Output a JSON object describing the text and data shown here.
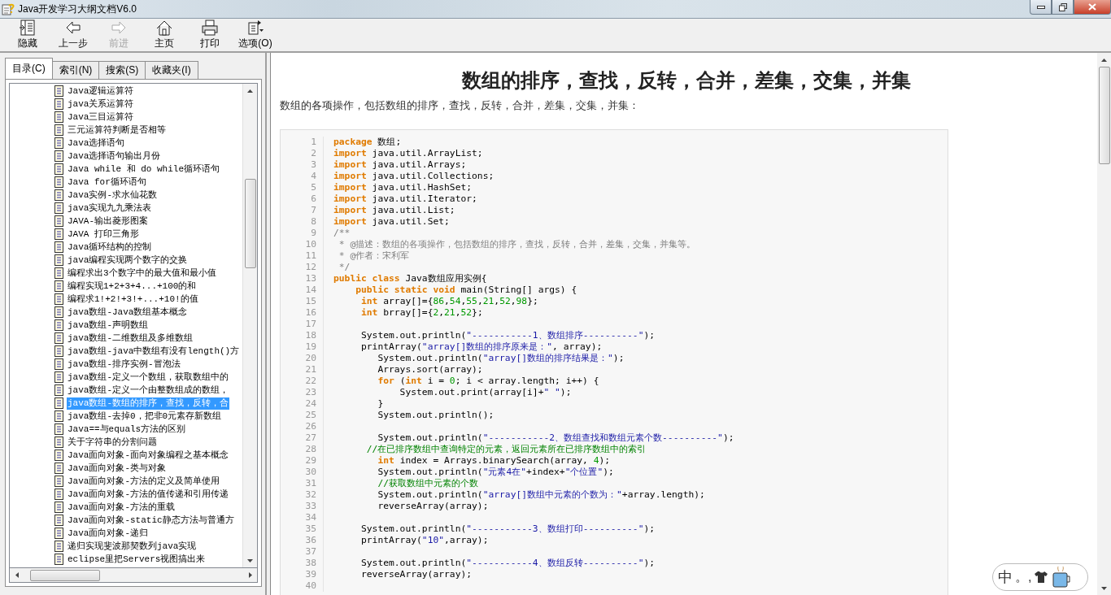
{
  "window": {
    "title": "Java开发学习大纲文档V6.0"
  },
  "toolbar": [
    {
      "label": "隐藏",
      "kind": "hide",
      "disabled": false
    },
    {
      "label": "上一步",
      "kind": "back",
      "disabled": false
    },
    {
      "label": "前进",
      "kind": "forward",
      "disabled": true
    },
    {
      "label": "主页",
      "kind": "home",
      "disabled": false
    },
    {
      "label": "打印",
      "kind": "print",
      "disabled": false
    },
    {
      "label": "选项(O)",
      "kind": "options",
      "disabled": false
    }
  ],
  "tabs": [
    {
      "label": "目录(C)",
      "selected": true
    },
    {
      "label": "索引(N)",
      "selected": false
    },
    {
      "label": "搜索(S)",
      "selected": false
    },
    {
      "label": "收藏夹(I)",
      "selected": false
    }
  ],
  "tree": {
    "items": [
      {
        "label": "Java逻辑运算符",
        "selected": false
      },
      {
        "label": "java关系运算符",
        "selected": false
      },
      {
        "label": "Java三目运算符",
        "selected": false
      },
      {
        "label": "三元运算符判断是否相等",
        "selected": false
      },
      {
        "label": "Java选择语句",
        "selected": false
      },
      {
        "label": "Java选择语句输出月份",
        "selected": false
      },
      {
        "label": "Java while 和 do while循环语句",
        "selected": false
      },
      {
        "label": "Java for循环语句",
        "selected": false
      },
      {
        "label": "Java实例-求水仙花数",
        "selected": false
      },
      {
        "label": "java实现九九乘法表",
        "selected": false
      },
      {
        "label": "JAVA-输出菱形图案",
        "selected": false
      },
      {
        "label": "JAVA 打印三角形",
        "selected": false
      },
      {
        "label": "Java循环结构的控制",
        "selected": false
      },
      {
        "label": "java编程实现两个数字的交换",
        "selected": false
      },
      {
        "label": "编程求出3个数字中的最大值和最小值",
        "selected": false
      },
      {
        "label": "编程实现1+2+3+4...+100的和",
        "selected": false
      },
      {
        "label": "编程求1!+2!+3!+...+10!的值",
        "selected": false
      },
      {
        "label": "java数组-Java数组基本概念",
        "selected": false
      },
      {
        "label": "java数组-声明数组",
        "selected": false
      },
      {
        "label": "java数组-二维数组及多维数组",
        "selected": false
      },
      {
        "label": "java数组-java中数组有没有length()方",
        "selected": false
      },
      {
        "label": "java数组-排序实例-冒泡法",
        "selected": false
      },
      {
        "label": "java数组-定义一个数组，获取数组中的",
        "selected": false
      },
      {
        "label": "java数组-定义一个由整数组成的数组，",
        "selected": false
      },
      {
        "label": "java数组-数组的排序，查找，反转，合",
        "selected": true
      },
      {
        "label": "java数组-去掉0，把非0元素存新数组",
        "selected": false
      },
      {
        "label": "Java==与equals方法的区别",
        "selected": false
      },
      {
        "label": "关于字符串的分割问题",
        "selected": false
      },
      {
        "label": "Java面向对象-面向对象编程之基本概念",
        "selected": false
      },
      {
        "label": "Java面向对象-类与对象",
        "selected": false
      },
      {
        "label": "Java面向对象-方法的定义及简单使用",
        "selected": false
      },
      {
        "label": "Java面向对象-方法的值传递和引用传递",
        "selected": false
      },
      {
        "label": "Java面向对象-方法的重载",
        "selected": false
      },
      {
        "label": "Java面向对象-static静态方法与普通方",
        "selected": false
      },
      {
        "label": "Java面向对象-递归",
        "selected": false
      },
      {
        "label": "递归实现斐波那契数列java实现",
        "selected": false
      },
      {
        "label": "eclipse里把Servers视图搞出来",
        "selected": false
      }
    ]
  },
  "article": {
    "heading": "数组的排序，查找，反转，合并，差集，交集，并集",
    "intro": "数组的各项操作，包括数组的排序，查找，反转，合并，差集，交集，并集：",
    "code": [
      {
        "no": "1",
        "tokens": [
          {
            "kind": "kw",
            "text": "package"
          },
          {
            "kind": "plain",
            "text": " 数组;"
          }
        ]
      },
      {
        "no": "2",
        "tokens": [
          {
            "kind": "kw",
            "text": "import"
          },
          {
            "kind": "plain",
            "text": " java.util.ArrayList;"
          }
        ]
      },
      {
        "no": "3",
        "tokens": [
          {
            "kind": "kw",
            "text": "import"
          },
          {
            "kind": "plain",
            "text": " java.util.Arrays;"
          }
        ]
      },
      {
        "no": "4",
        "tokens": [
          {
            "kind": "kw",
            "text": "import"
          },
          {
            "kind": "plain",
            "text": " java.util.Collections;"
          }
        ]
      },
      {
        "no": "5",
        "tokens": [
          {
            "kind": "kw",
            "text": "import"
          },
          {
            "kind": "plain",
            "text": " java.util.HashSet;"
          }
        ]
      },
      {
        "no": "6",
        "tokens": [
          {
            "kind": "kw",
            "text": "import"
          },
          {
            "kind": "plain",
            "text": " java.util.Iterator;"
          }
        ]
      },
      {
        "no": "7",
        "tokens": [
          {
            "kind": "kw",
            "text": "import"
          },
          {
            "kind": "plain",
            "text": " java.util.List;"
          }
        ]
      },
      {
        "no": "8",
        "tokens": [
          {
            "kind": "kw",
            "text": "import"
          },
          {
            "kind": "plain",
            "text": " java.util.Set;"
          }
        ]
      },
      {
        "no": "9",
        "tokens": [
          {
            "kind": "doc",
            "text": "/**"
          }
        ]
      },
      {
        "no": "10",
        "tokens": [
          {
            "kind": "doc",
            "text": " * @描述：数组的各项操作，包括数组的排序，查找，反转，合并，差集，交集，并集等。"
          }
        ]
      },
      {
        "no": "11",
        "tokens": [
          {
            "kind": "doc",
            "text": " * @作者：宋利军"
          }
        ]
      },
      {
        "no": "12",
        "tokens": [
          {
            "kind": "doc",
            "text": " */"
          }
        ]
      },
      {
        "no": "13",
        "tokens": [
          {
            "kind": "kw",
            "text": "public class"
          },
          {
            "kind": "plain",
            "text": " Java数组应用实例{"
          }
        ]
      },
      {
        "no": "14",
        "tokens": [
          {
            "kind": "kw",
            "text": "    public static void"
          },
          {
            "kind": "plain",
            "text": " main(String[] args) {"
          }
        ]
      },
      {
        "no": "15",
        "tokens": [
          {
            "kind": "kw",
            "text": "     int"
          },
          {
            "kind": "plain",
            "text": " array[]={"
          },
          {
            "kind": "num",
            "text": "86"
          },
          {
            "kind": "plain",
            "text": ","
          },
          {
            "kind": "num",
            "text": "54"
          },
          {
            "kind": "plain",
            "text": ","
          },
          {
            "kind": "num",
            "text": "55"
          },
          {
            "kind": "plain",
            "text": ","
          },
          {
            "kind": "num",
            "text": "21"
          },
          {
            "kind": "plain",
            "text": ","
          },
          {
            "kind": "num",
            "text": "52"
          },
          {
            "kind": "plain",
            "text": ","
          },
          {
            "kind": "num",
            "text": "98"
          },
          {
            "kind": "plain",
            "text": "};"
          }
        ]
      },
      {
        "no": "16",
        "tokens": [
          {
            "kind": "kw",
            "text": "     int"
          },
          {
            "kind": "plain",
            "text": " brray[]={"
          },
          {
            "kind": "num",
            "text": "2"
          },
          {
            "kind": "plain",
            "text": ","
          },
          {
            "kind": "num",
            "text": "21"
          },
          {
            "kind": "plain",
            "text": ","
          },
          {
            "kind": "num",
            "text": "52"
          },
          {
            "kind": "plain",
            "text": "};"
          }
        ]
      },
      {
        "no": "17"
      },
      {
        "no": "18",
        "tokens": [
          {
            "kind": "plain",
            "text": "     System.out.println("
          },
          {
            "kind": "str",
            "text": "\"-----------1、数组排序----------\""
          },
          {
            "kind": "plain",
            "text": ");"
          }
        ]
      },
      {
        "no": "19",
        "tokens": [
          {
            "kind": "plain",
            "text": "     printArray("
          },
          {
            "kind": "str",
            "text": "\"array[]数组的排序原来是：\""
          },
          {
            "kind": "plain",
            "text": ", array);"
          }
        ]
      },
      {
        "no": "20",
        "tokens": [
          {
            "kind": "plain",
            "text": "        System.out.println("
          },
          {
            "kind": "str",
            "text": "\"array[]数组的排序结果是：\""
          },
          {
            "kind": "plain",
            "text": ");"
          }
        ]
      },
      {
        "no": "21",
        "tokens": [
          {
            "kind": "plain",
            "text": "        Arrays.sort(array);"
          }
        ]
      },
      {
        "no": "22",
        "tokens": [
          {
            "kind": "kw",
            "text": "        for"
          },
          {
            "kind": "plain",
            "text": " ("
          },
          {
            "kind": "kw",
            "text": "int"
          },
          {
            "kind": "plain",
            "text": " i = "
          },
          {
            "kind": "num",
            "text": "0"
          },
          {
            "kind": "plain",
            "text": "; i < array.length; i++) {"
          }
        ]
      },
      {
        "no": "23",
        "tokens": [
          {
            "kind": "plain",
            "text": "            System.out.print(array[i]+"
          },
          {
            "kind": "str",
            "text": "\" \""
          },
          {
            "kind": "plain",
            "text": ");"
          }
        ]
      },
      {
        "no": "24",
        "tokens": [
          {
            "kind": "plain",
            "text": "        }"
          }
        ]
      },
      {
        "no": "25",
        "tokens": [
          {
            "kind": "plain",
            "text": "        System.out.println();"
          }
        ]
      },
      {
        "no": "26"
      },
      {
        "no": "27",
        "tokens": [
          {
            "kind": "plain",
            "text": "        System.out.println("
          },
          {
            "kind": "str",
            "text": "\"-----------2、数组查找和数组元素个数----------\""
          },
          {
            "kind": "plain",
            "text": ");"
          }
        ]
      },
      {
        "no": "28",
        "tokens": [
          {
            "kind": "cmt",
            "text": "      //在已排序数组中查询特定的元素，返回元素所在已排序数组中的索引"
          }
        ]
      },
      {
        "no": "29",
        "tokens": [
          {
            "kind": "kw",
            "text": "        int"
          },
          {
            "kind": "plain",
            "text": " index = Arrays.binarySearch(array, "
          },
          {
            "kind": "num",
            "text": "4"
          },
          {
            "kind": "plain",
            "text": ");"
          }
        ]
      },
      {
        "no": "30",
        "tokens": [
          {
            "kind": "plain",
            "text": "        System.out.println("
          },
          {
            "kind": "str",
            "text": "\"元素4在\""
          },
          {
            "kind": "plain",
            "text": "+index+"
          },
          {
            "kind": "str",
            "text": "\"个位置\""
          },
          {
            "kind": "plain",
            "text": ");"
          }
        ]
      },
      {
        "no": "31",
        "tokens": [
          {
            "kind": "cmt",
            "text": "        //获取数组中元素的个数"
          }
        ]
      },
      {
        "no": "32",
        "tokens": [
          {
            "kind": "plain",
            "text": "        System.out.println("
          },
          {
            "kind": "str",
            "text": "\"array[]数组中元素的个数为：\""
          },
          {
            "kind": "plain",
            "text": "+array.length);"
          }
        ]
      },
      {
        "no": "33",
        "tokens": [
          {
            "kind": "plain",
            "text": "        reverseArray(array);"
          }
        ]
      },
      {
        "no": "34"
      },
      {
        "no": "35",
        "tokens": [
          {
            "kind": "plain",
            "text": "     System.out.println("
          },
          {
            "kind": "str",
            "text": "\"-----------3、数组打印----------\""
          },
          {
            "kind": "plain",
            "text": ");"
          }
        ]
      },
      {
        "no": "36",
        "tokens": [
          {
            "kind": "plain",
            "text": "     printArray("
          },
          {
            "kind": "str",
            "text": "\"10\""
          },
          {
            "kind": "plain",
            "text": ",array);"
          }
        ]
      },
      {
        "no": "37"
      },
      {
        "no": "38",
        "tokens": [
          {
            "kind": "plain",
            "text": "     System.out.println("
          },
          {
            "kind": "str",
            "text": "\"-----------4、数组反转----------\""
          },
          {
            "kind": "plain",
            "text": ");"
          }
        ]
      },
      {
        "no": "39",
        "tokens": [
          {
            "kind": "plain",
            "text": "     reverseArray(array);"
          }
        ]
      },
      {
        "no": "40"
      }
    ]
  },
  "ime": {
    "mode": "中",
    "punctuation": "。,"
  }
}
